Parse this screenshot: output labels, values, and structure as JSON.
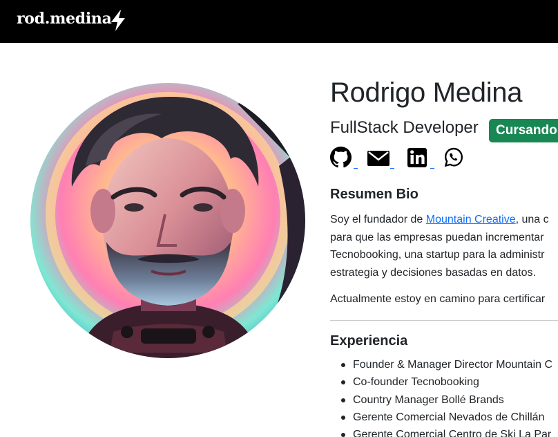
{
  "nav": {
    "brand": "rod.medina",
    "bolt_icon": "lightning-bolt-icon"
  },
  "profile": {
    "name": "Rodrigo Medina",
    "role": "FullStack Developer",
    "badge": "Cursando",
    "badge_color": "#198754",
    "social": [
      {
        "icon": "github-icon"
      },
      {
        "icon": "envelope-icon"
      },
      {
        "icon": "linkedin-icon"
      },
      {
        "icon": "whatsapp-icon"
      }
    ]
  },
  "bio": {
    "heading": "Resumen Bio",
    "line1_prefix": "Soy el fundador de ",
    "company_link": "Mountain Creative",
    "line1_suffix": ", una c",
    "line2": "para que las empresas puedan incrementar",
    "line3": "Tecnobooking, una startup para la administr",
    "line4": "estrategia y decisiones basadas en datos.",
    "current": "Actualmente estoy en camino para certificar"
  },
  "experience": {
    "heading": "Experiencia",
    "items": [
      "Founder & Manager Director Mountain C",
      "Co-founder Tecnobooking",
      "Country Manager Bollé Brands",
      "Gerente Comercial Nevados de Chillán",
      "Gerente Comercial Centro de Ski La Par"
    ]
  },
  "colors": {
    "navbar": "#000000",
    "link": "#0d6efd",
    "text": "#212529"
  }
}
